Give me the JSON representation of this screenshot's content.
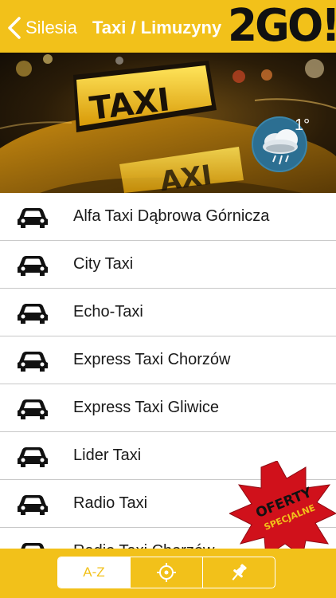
{
  "header": {
    "back_label": "Silesia",
    "title": "Taxi / Limuzyny",
    "logo": "2GO!"
  },
  "banner": {
    "taxi_sign_text": "TAXI",
    "weather": {
      "temperature": "1°",
      "icon": "rain-cloud-icon"
    }
  },
  "list": {
    "items": [
      {
        "label": "Alfa Taxi Dąbrowa Górnicza",
        "icon": "car-icon"
      },
      {
        "label": "City Taxi",
        "icon": "car-icon"
      },
      {
        "label": "Echo-Taxi",
        "icon": "car-icon"
      },
      {
        "label": "Express Taxi Chorzów",
        "icon": "car-icon"
      },
      {
        "label": "Express Taxi Gliwice",
        "icon": "car-icon"
      },
      {
        "label": "Lider Taxi",
        "icon": "car-icon"
      },
      {
        "label": "Radio Taxi",
        "icon": "car-icon"
      },
      {
        "label": "Radio Taxi Chorzów",
        "icon": "car-icon"
      }
    ]
  },
  "offers_badge": {
    "line1": "OFERTY",
    "line2": "SPECJALNE"
  },
  "bottom_bar": {
    "tabs": [
      {
        "label": "A-Z",
        "active": true
      },
      {
        "icon": "locate-crosshair-icon"
      },
      {
        "icon": "pin-icon"
      }
    ]
  },
  "colors": {
    "accent": "#f2c11a",
    "badge_red": "#d0111b"
  }
}
